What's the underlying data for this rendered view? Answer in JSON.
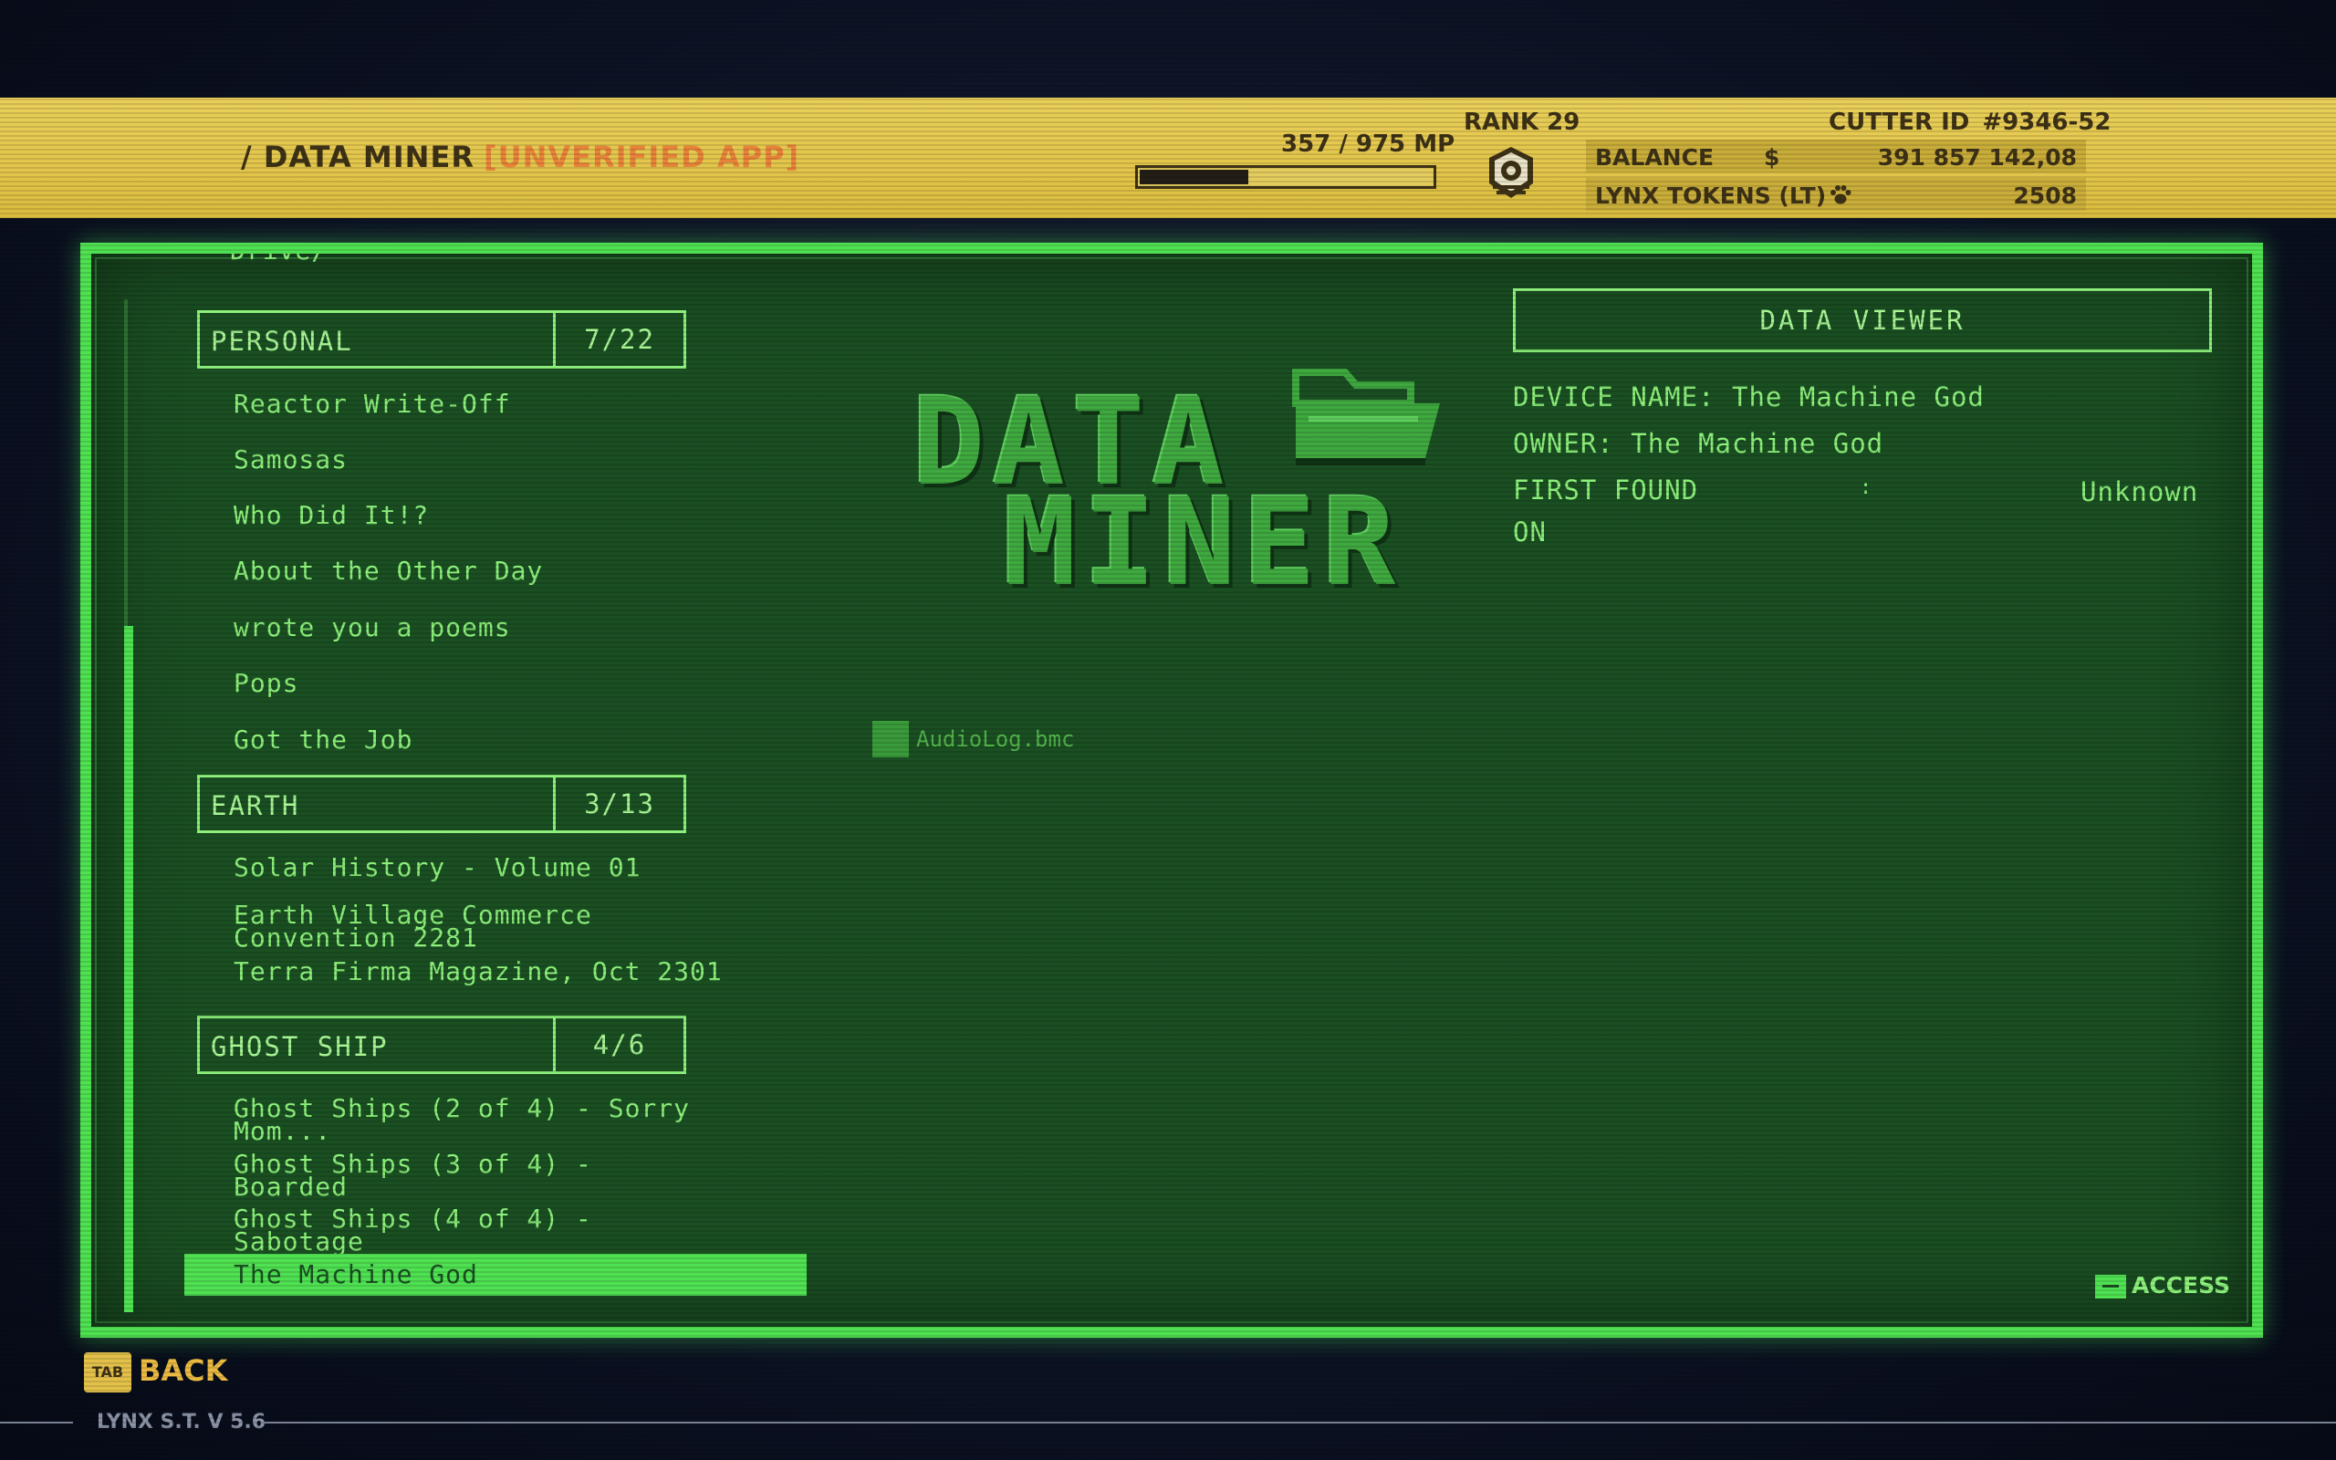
{
  "header": {
    "app_title": "/ DATA MINER",
    "app_status": "[UNVERIFIED APP]",
    "mp_text": "357 / 975 MP",
    "mp_progress": 0.366,
    "rank": "RANK 29",
    "cutter_id_label": "CUTTER ID",
    "cutter_id": "#9346-52",
    "balance_label": "BALANCE",
    "balance_symbol": "$",
    "balance_value": "391 857 142,08",
    "tokens_label": "LYNX TOKENS (LT)",
    "tokens_value": "2508"
  },
  "list": {
    "cut_item": "Drive/",
    "categories": [
      {
        "name": "PERSONAL",
        "count": "7/22",
        "entries": [
          "Reactor Write-Off",
          "Samosas",
          "Who Did It!?",
          "About the Other Day",
          "wrote you a poems",
          "Pops",
          "Got the Job"
        ]
      },
      {
        "name": "EARTH",
        "count": "3/13",
        "entries": [
          "Solar History - Volume 01",
          "Earth Village Commerce Convention 2281",
          "Terra Firma Magazine, Oct 2301"
        ]
      },
      {
        "name": "GHOST SHIP",
        "count": "4/6",
        "entries": [
          "Ghost Ships (2 of 4) - Sorry Mom...",
          "Ghost Ships (3 of 4) - Boarded",
          "Ghost Ships (4 of 4) - Sabotage",
          "The Machine God"
        ]
      }
    ],
    "selected_entry": "The Machine God"
  },
  "logo": {
    "line1": "DATA",
    "line2": "MINER",
    "icon": "folder-icon"
  },
  "files": [
    {
      "name": "AudioLog.bmc",
      "icon": "file-icon"
    }
  ],
  "viewer": {
    "title": "DATA VIEWER",
    "device_name_label": "DEVICE NAME:",
    "device_name": "The Machine God",
    "owner_label": "OWNER:",
    "owner": "The Machine God",
    "first_found_label": "FIRST FOUND",
    "first_found_label2": "ON",
    "first_found_colon": ":",
    "first_found_value": "Unknown"
  },
  "actions": {
    "access_label": "ACCESS",
    "back_key": "TAB",
    "back_label": "BACK"
  },
  "footer": {
    "version": "LYNX S.T. V 5.6"
  },
  "colors": {
    "terminal_green": "#4fe152",
    "text_green": "#8cf07a",
    "screen_bg": "#1a4f22",
    "header_yellow": "#e3c64c",
    "unverified_orange": "#e8833a"
  }
}
